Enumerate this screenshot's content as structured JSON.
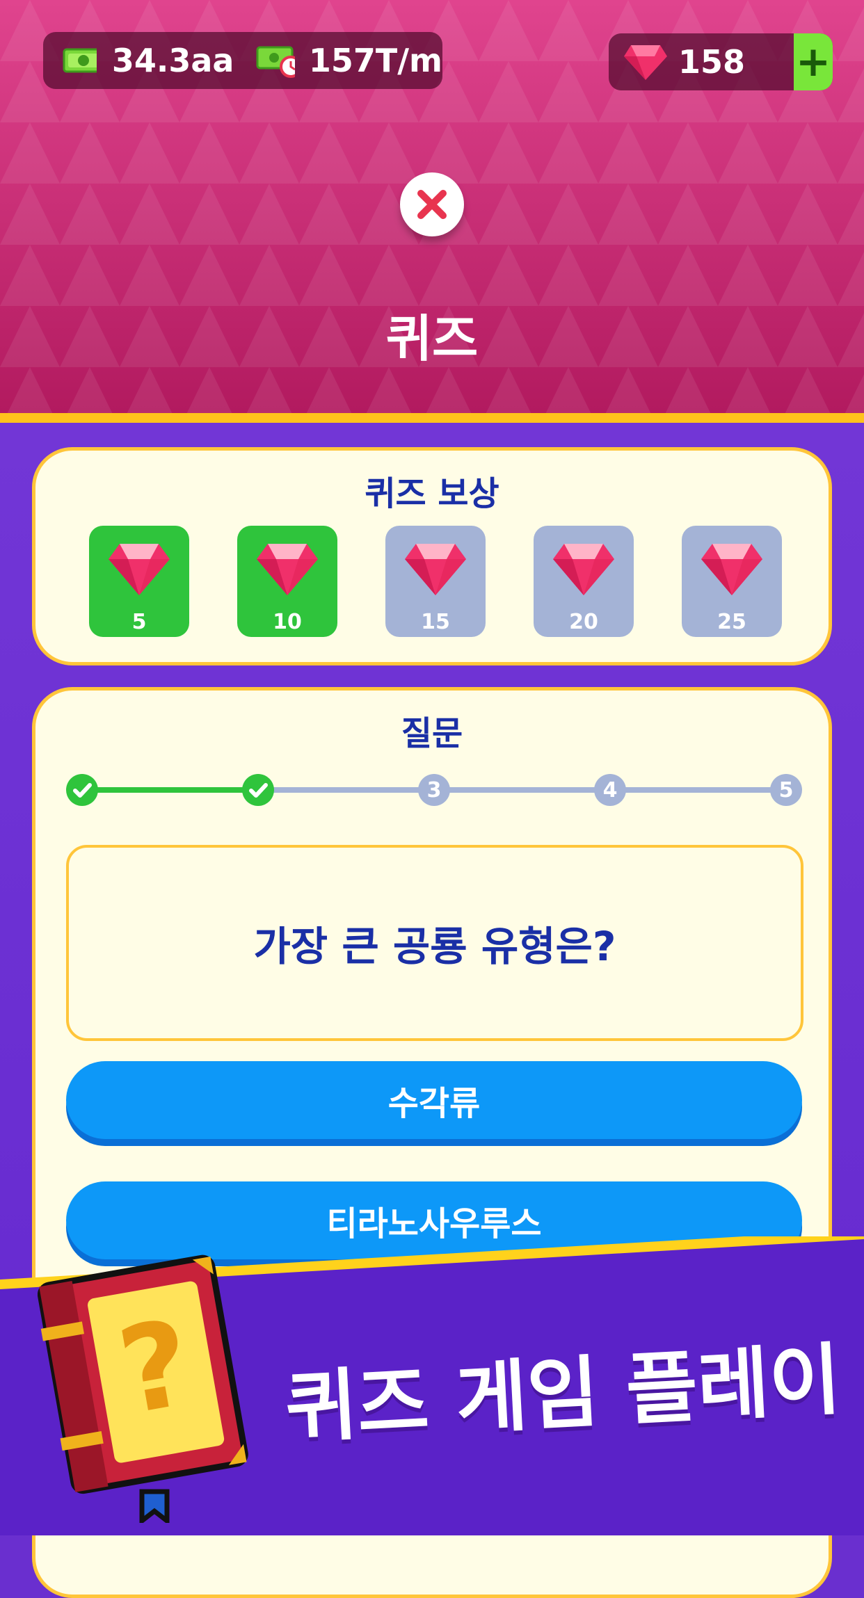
{
  "header": {
    "cash_amount": "34.3aa",
    "income_rate": "157T/m",
    "gems": "158",
    "plus_label": "+",
    "title": "퀴즈"
  },
  "rewards": {
    "title": "퀴즈 보상",
    "items": [
      {
        "amount": "5",
        "claimed": true
      },
      {
        "amount": "10",
        "claimed": true
      },
      {
        "amount": "15",
        "claimed": false
      },
      {
        "amount": "20",
        "claimed": false
      },
      {
        "amount": "25",
        "claimed": false
      }
    ]
  },
  "question": {
    "title": "질문",
    "progress": [
      {
        "label": "",
        "done": true
      },
      {
        "label": "",
        "done": true
      },
      {
        "label": "3",
        "done": false
      },
      {
        "label": "4",
        "done": false
      },
      {
        "label": "5",
        "done": false
      }
    ],
    "text": "가장 큰 공룡 유형은?",
    "answers": [
      "수각류",
      "티라노사우루스"
    ]
  },
  "banner": {
    "text": "퀴즈 게임 플레이",
    "book_glyph": "?"
  },
  "colors": {
    "header_pink": "#e0448e",
    "panel_cream": "#fffde6",
    "accent_gold": "#ffc53a",
    "claimed_green": "#2fc43c",
    "locked_gray": "#a4b3d6",
    "answer_blue": "#0d98f8",
    "text_navy": "#1a2fa6"
  }
}
